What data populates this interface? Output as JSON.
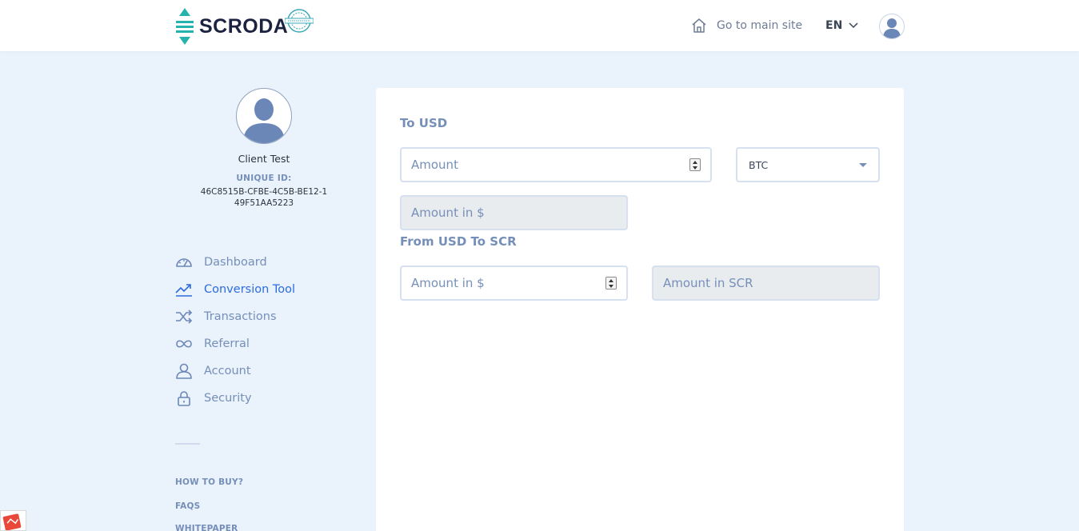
{
  "brand": {
    "name": "SCRODA"
  },
  "header": {
    "main_site_label": "Go to main site",
    "language": "EN"
  },
  "profile": {
    "name": "Client Test",
    "unique_id_label": "UNIQUE ID:",
    "unique_id_value": "46C8515B-CFBE-4C5B-BE12-149F51AA5223"
  },
  "sidebar": {
    "items": [
      {
        "label": "Dashboard",
        "icon": "dashboard-icon",
        "active": false
      },
      {
        "label": "Conversion Tool",
        "icon": "trend-chart-icon",
        "active": true
      },
      {
        "label": "Transactions",
        "icon": "shuffle-icon",
        "active": false
      },
      {
        "label": "Referral",
        "icon": "infinity-icon",
        "active": false
      },
      {
        "label": "Account",
        "icon": "user-icon",
        "active": false
      },
      {
        "label": "Security",
        "icon": "lock-icon",
        "active": false
      }
    ],
    "links": [
      "HOW TO BUY?",
      "FAQS",
      "WHITEPAPER"
    ]
  },
  "converter": {
    "to_usd": {
      "title": "To USD",
      "amount_placeholder": "Amount",
      "currency_selected": "BTC",
      "result_placeholder": "Amount in $"
    },
    "usd_to_scr": {
      "title": "From USD To SCR",
      "amount_placeholder": "Amount in $",
      "result_placeholder": "Amount in SCR"
    }
  },
  "colors": {
    "accent": "#2c6ce0",
    "muted": "#758fb9",
    "background": "#eaf2fb",
    "logo_teal": "#27b3ad"
  }
}
